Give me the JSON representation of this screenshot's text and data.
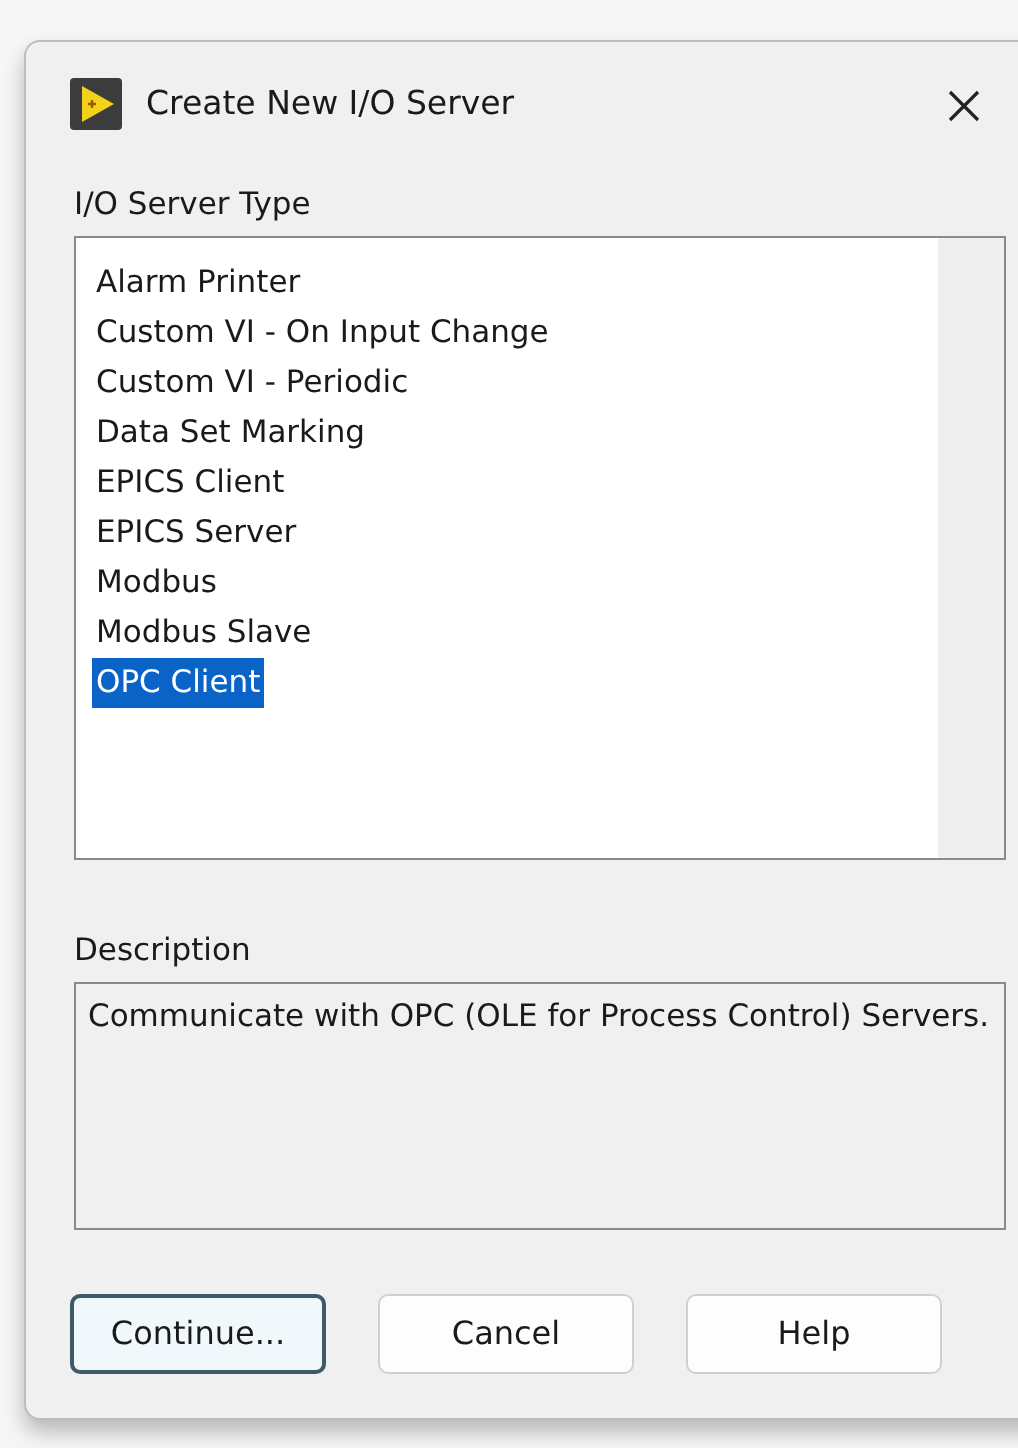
{
  "window": {
    "title": "Create New I/O Server"
  },
  "server_type": {
    "label": "I/O Server Type",
    "items": [
      {
        "label": "Alarm Printer",
        "selected": false
      },
      {
        "label": "Custom VI - On Input Change",
        "selected": false
      },
      {
        "label": "Custom VI - Periodic",
        "selected": false
      },
      {
        "label": "Data Set Marking",
        "selected": false
      },
      {
        "label": "EPICS Client",
        "selected": false
      },
      {
        "label": "EPICS Server",
        "selected": false
      },
      {
        "label": "Modbus",
        "selected": false
      },
      {
        "label": "Modbus Slave",
        "selected": false
      },
      {
        "label": "OPC Client",
        "selected": true
      }
    ]
  },
  "description": {
    "label": "Description",
    "text": "Communicate with OPC (OLE for Process Control) Servers."
  },
  "buttons": [
    {
      "label": "Continue...",
      "default": true
    },
    {
      "label": "Cancel",
      "default": false
    },
    {
      "label": "Help",
      "default": false
    }
  ]
}
